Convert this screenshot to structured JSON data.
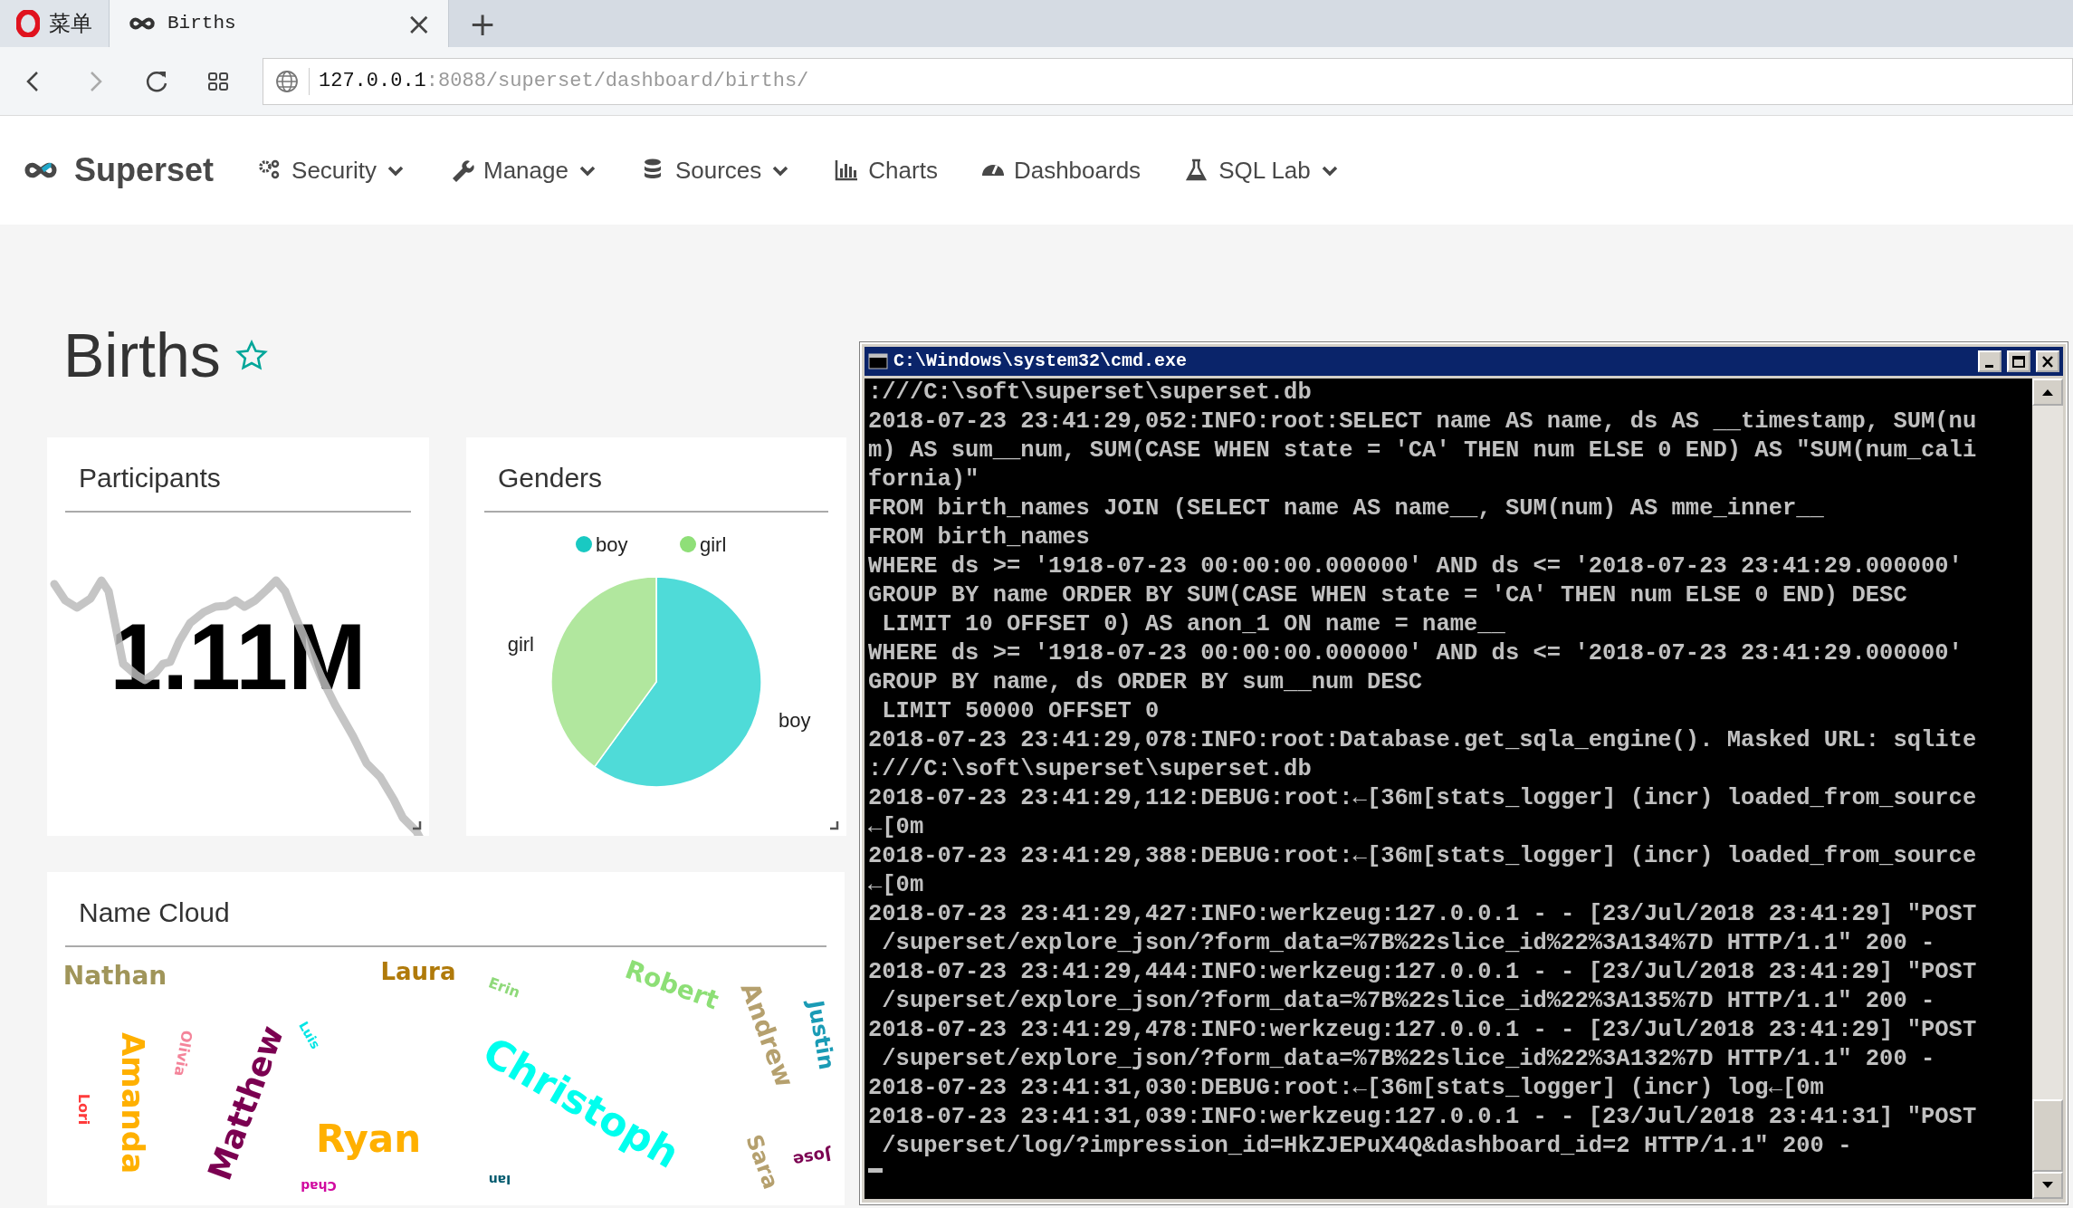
{
  "browser": {
    "tabs": [
      {
        "label": "菜单",
        "kind": "menu",
        "selected": false
      },
      {
        "label": "Births",
        "kind": "page",
        "selected": true,
        "close": "×"
      }
    ],
    "new_tab": "+",
    "address": {
      "host": "127.0.0.1",
      "path": ":8088/superset/dashboard/births/"
    }
  },
  "navbar": {
    "brand": "Superset",
    "items": [
      {
        "label": "Security",
        "dropdown": true
      },
      {
        "label": "Manage",
        "dropdown": true
      },
      {
        "label": "Sources",
        "dropdown": true
      },
      {
        "label": "Charts",
        "dropdown": false
      },
      {
        "label": "Dashboards",
        "dropdown": false
      },
      {
        "label": "SQL Lab",
        "dropdown": true
      }
    ]
  },
  "dashboard": {
    "title": "Births",
    "favorite": false,
    "participants": {
      "title": "Participants",
      "value": "1.11M"
    },
    "genders": {
      "title": "Genders",
      "chart_data": {
        "type": "pie",
        "categories": [
          "boy",
          "girl"
        ],
        "values": [
          60,
          40
        ]
      }
    },
    "name_cloud": {
      "title": "Name Cloud",
      "words": [
        {
          "text": "Nathan",
          "color": "#a0955a"
        },
        {
          "text": "Laura",
          "color": "#b07a0a"
        },
        {
          "text": "Andrew",
          "color": "#b5a06e"
        },
        {
          "text": "Justin",
          "color": "#1a9bb5"
        },
        {
          "text": "Amanda",
          "color": "#ffb000"
        },
        {
          "text": "Olivia",
          "color": "#f4849a"
        },
        {
          "text": "Matthew",
          "color": "#7b0051"
        },
        {
          "text": "Luis",
          "color": "#00e5e5"
        },
        {
          "text": "Erin",
          "color": "#8fd97a"
        },
        {
          "text": "Robert",
          "color": "#8ddf76"
        },
        {
          "text": "Christoph",
          "color": "#00ffee"
        },
        {
          "text": "Ryan",
          "color": "#ffb000"
        },
        {
          "text": "Sara",
          "color": "#b5a06e"
        },
        {
          "text": "Jose",
          "color": "#7b0051"
        },
        {
          "text": "Lori",
          "color": "#ff3b3b"
        },
        {
          "text": "Chad",
          "color": "#d10aa0"
        },
        {
          "text": "Ian",
          "color": "#005a6e"
        }
      ]
    }
  },
  "console": {
    "title": "C:\\Windows\\system32\\cmd.exe",
    "lines": [
      ":///C:\\soft\\superset\\superset.db",
      "2018-07-23 23:41:29,052:INFO:root:SELECT name AS name, ds AS __timestamp, SUM(nu",
      "m) AS sum__num, SUM(CASE WHEN state = 'CA' THEN num ELSE 0 END) AS \"SUM(num_cali",
      "fornia)\"",
      "FROM birth_names JOIN (SELECT name AS name__, SUM(num) AS mme_inner__",
      "FROM birth_names",
      "WHERE ds >= '1918-07-23 00:00:00.000000' AND ds <= '2018-07-23 23:41:29.000000'",
      "GROUP BY name ORDER BY SUM(CASE WHEN state = 'CA' THEN num ELSE 0 END) DESC",
      " LIMIT 10 OFFSET 0) AS anon_1 ON name = name__",
      "WHERE ds >= '1918-07-23 00:00:00.000000' AND ds <= '2018-07-23 23:41:29.000000'",
      "GROUP BY name, ds ORDER BY sum__num DESC",
      " LIMIT 50000 OFFSET 0",
      "2018-07-23 23:41:29,078:INFO:root:Database.get_sqla_engine(). Masked URL: sqlite",
      ":///C:\\soft\\superset\\superset.db",
      "2018-07-23 23:41:29,112:DEBUG:root:←[36m[stats_logger] (incr) loaded_from_source",
      "←[0m",
      "2018-07-23 23:41:29,388:DEBUG:root:←[36m[stats_logger] (incr) loaded_from_source",
      "←[0m",
      "2018-07-23 23:41:29,427:INFO:werkzeug:127.0.0.1 - - [23/Jul/2018 23:41:29] \"POST",
      " /superset/explore_json/?form_data=%7B%22slice_id%22%3A134%7D HTTP/1.1\" 200 -",
      "2018-07-23 23:41:29,444:INFO:werkzeug:127.0.0.1 - - [23/Jul/2018 23:41:29] \"POST",
      " /superset/explore_json/?form_data=%7B%22slice_id%22%3A135%7D HTTP/1.1\" 200 -",
      "2018-07-23 23:41:29,478:INFO:werkzeug:127.0.0.1 - - [23/Jul/2018 23:41:29] \"POST",
      " /superset/explore_json/?form_data=%7B%22slice_id%22%3A132%7D HTTP/1.1\" 200 -",
      "2018-07-23 23:41:31,030:DEBUG:root:←[36m[stats_logger] (incr) log←[0m",
      "2018-07-23 23:41:31,039:INFO:werkzeug:127.0.0.1 - - [23/Jul/2018 23:41:31] \"POST",
      " /superset/log/?impression_id=HkZJEPuX4Q&dashboard_id=2 HTTP/1.1\" 200 -"
    ]
  }
}
